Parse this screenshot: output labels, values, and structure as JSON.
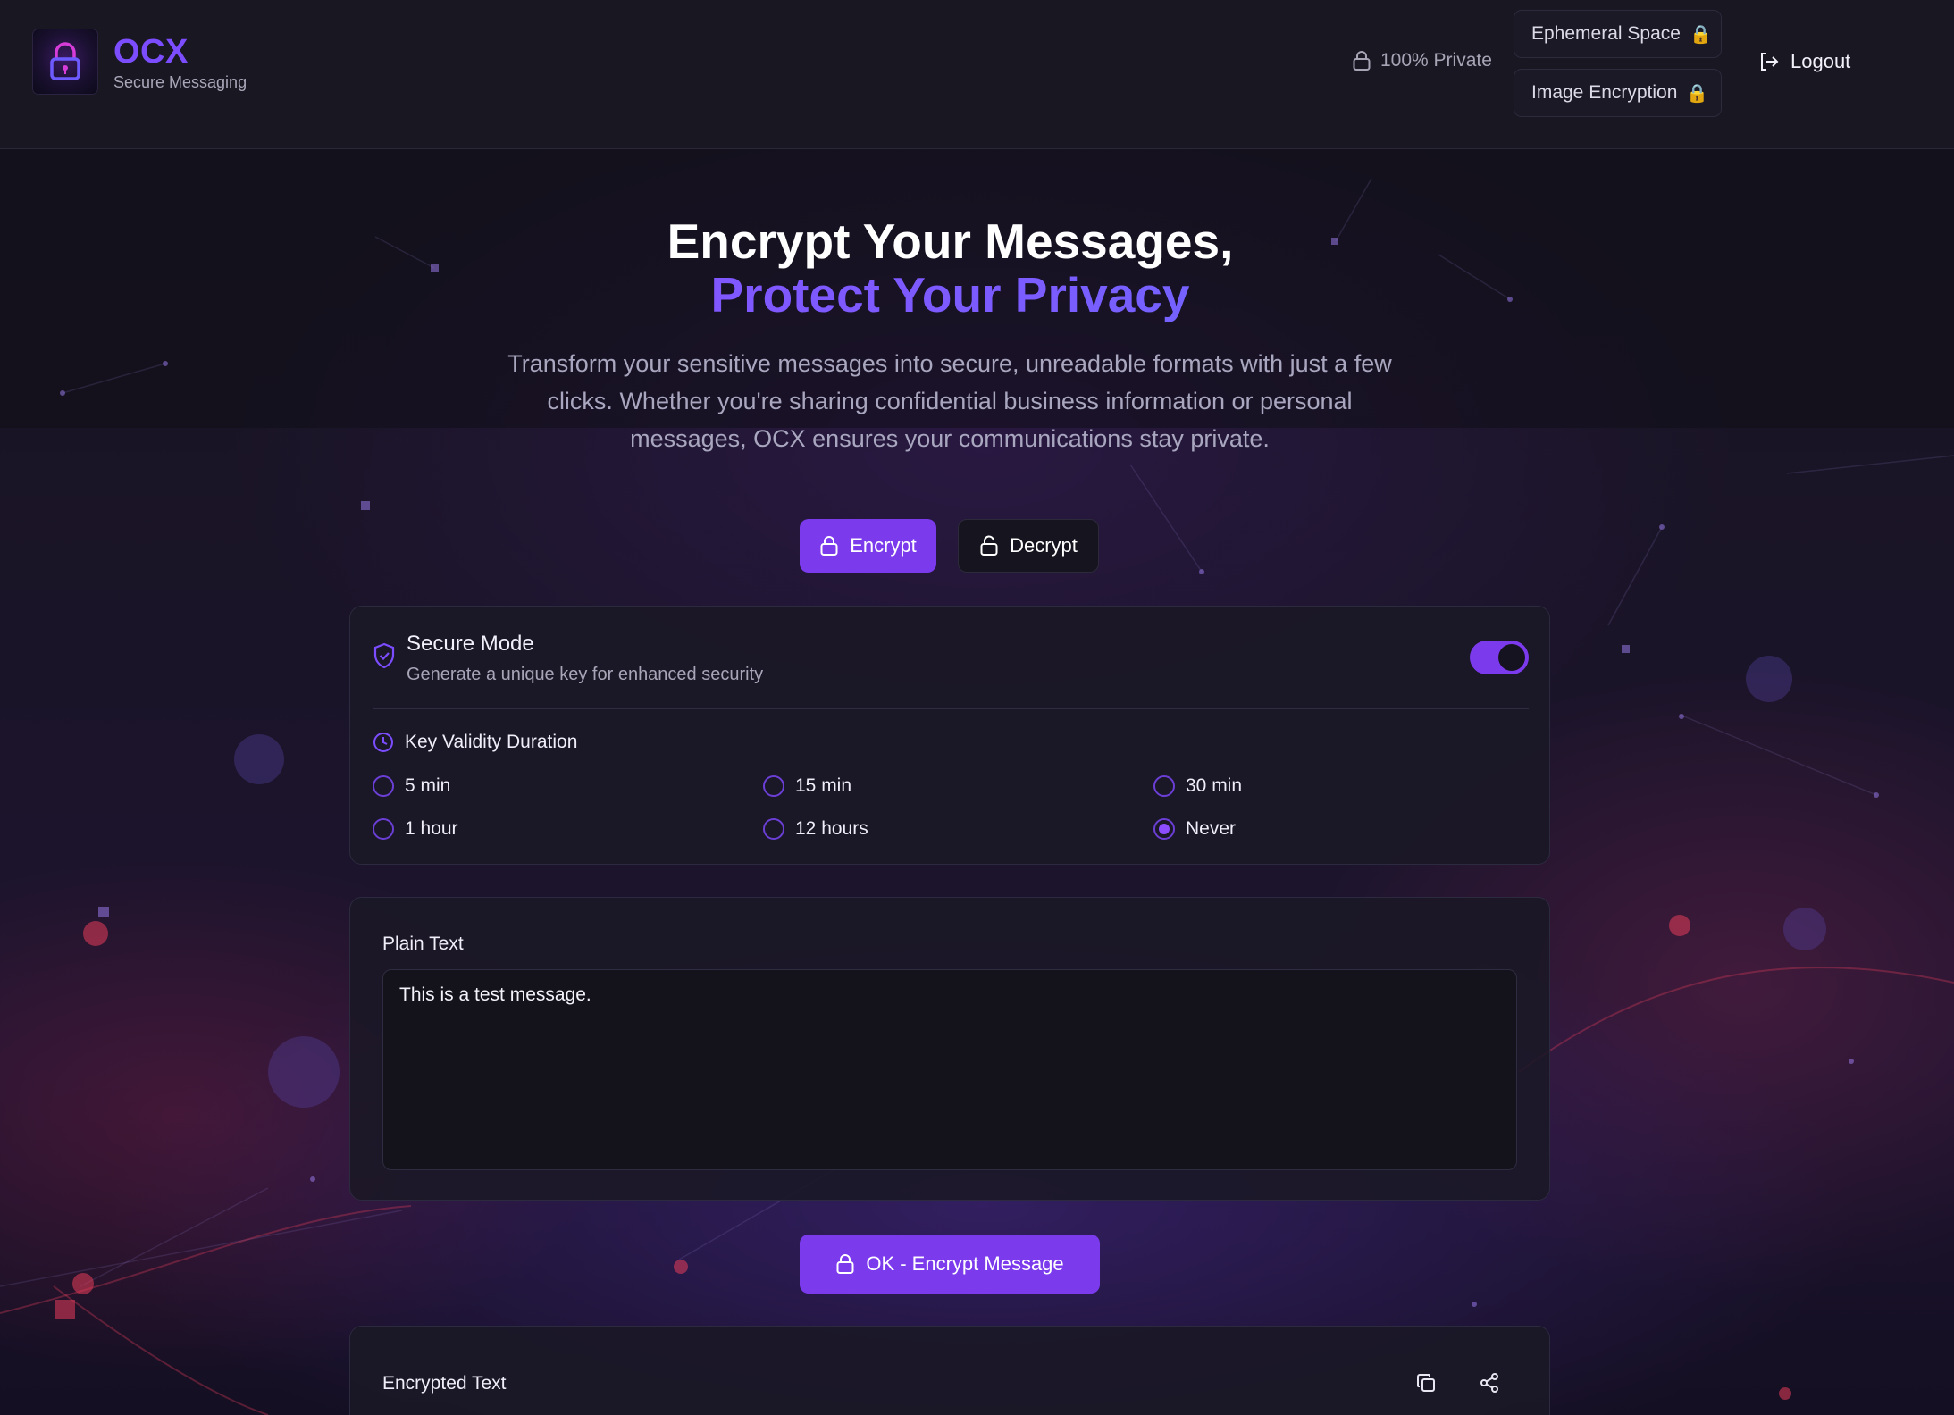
{
  "brand": {
    "name": "OCX",
    "tagline": "Secure Messaging"
  },
  "header": {
    "privacy_label": "100% Private",
    "pills": [
      {
        "label": "Ephemeral Space",
        "icon": "lock-emoji"
      },
      {
        "label": "Image Encryption",
        "icon": "lock-emoji"
      }
    ],
    "pill_lock_glyph": "🔒",
    "logout_label": "Logout"
  },
  "hero": {
    "title_line1": "Encrypt Your Messages,",
    "title_line2": "Protect Your Privacy",
    "description": "Transform your sensitive messages into secure, unreadable formats with just a few clicks. Whether you're sharing confidential business information or personal messages, OCX ensures your communications stay private."
  },
  "modes": {
    "encrypt_label": "Encrypt",
    "decrypt_label": "Decrypt",
    "active": "Encrypt"
  },
  "secure_mode": {
    "title": "Secure Mode",
    "subtitle": "Generate a unique key for enhanced security",
    "enabled": true,
    "duration_label": "Key Validity Duration",
    "options": [
      "5 min",
      "15 min",
      "30 min",
      "1 hour",
      "12 hours",
      "Never"
    ],
    "selected": "Never"
  },
  "plain_text": {
    "label": "Plain Text",
    "value": "This is a test message."
  },
  "encrypt_button_label": "OK - Encrypt Message",
  "encrypted_text": {
    "label": "Encrypted Text"
  },
  "colors": {
    "accent": "#7c3aed",
    "brand": "#7c4dff",
    "background": "#12101c",
    "lock_emoji": "#e0a43a"
  }
}
